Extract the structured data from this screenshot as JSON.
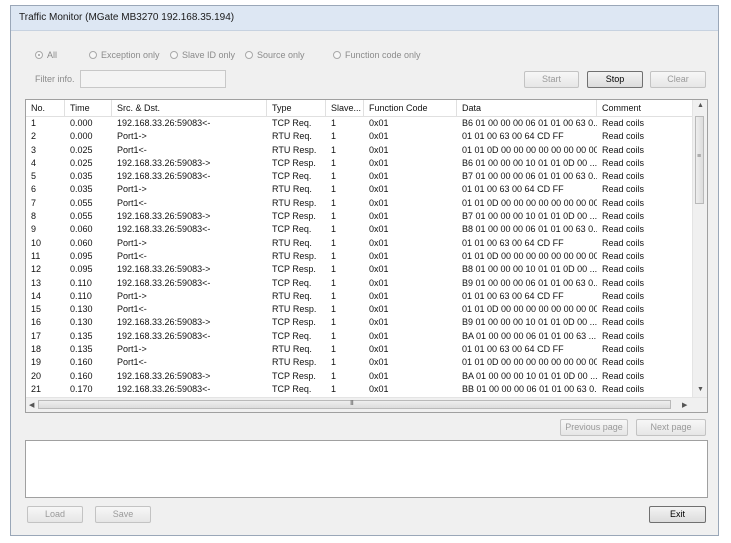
{
  "window": {
    "title": "Traffic Monitor (MGate MB3270 192.168.35.194)"
  },
  "filters": {
    "options": [
      {
        "label": "All",
        "selected": true
      },
      {
        "label": "Exception only",
        "selected": false
      },
      {
        "label": "Slave ID only",
        "selected": false
      },
      {
        "label": "Source only",
        "selected": false
      },
      {
        "label": "Function code only",
        "selected": false
      }
    ],
    "filter_label": "Filter info.",
    "filter_value": ""
  },
  "buttons": {
    "start": "Start",
    "stop": "Stop",
    "clear": "Clear",
    "previous_page": "Previous page",
    "next_page": "Next page",
    "load": "Load",
    "save": "Save",
    "exit": "Exit"
  },
  "table": {
    "columns": [
      "No.",
      "Time",
      "Src. & Dst.",
      "Type",
      "Slave...",
      "Function Code",
      "Data",
      "Comment"
    ],
    "rows": [
      [
        "1",
        "0.000",
        "192.168.33.26:59083<-",
        "TCP Req.",
        "1",
        "0x01",
        "B6 01 00 00 00 06 01 01 00 63 0...",
        "Read coils"
      ],
      [
        "2",
        "0.000",
        "Port1->",
        "RTU Req.",
        "1",
        "0x01",
        "01 01 00 63 00 64 CD FF",
        "Read coils"
      ],
      [
        "3",
        "0.025",
        "Port1<-",
        "RTU Resp.",
        "1",
        "0x01",
        "01 01 0D 00 00 00 00 00 00 00 00 ...",
        "Read coils"
      ],
      [
        "4",
        "0.025",
        "192.168.33.26:59083->",
        "TCP Resp.",
        "1",
        "0x01",
        "B6 01 00 00 00 10 01 01 0D 00 ...",
        "Read coils"
      ],
      [
        "5",
        "0.035",
        "192.168.33.26:59083<-",
        "TCP Req.",
        "1",
        "0x01",
        "B7 01 00 00 00 06 01 01 00 63 0...",
        "Read coils"
      ],
      [
        "6",
        "0.035",
        "Port1->",
        "RTU Req.",
        "1",
        "0x01",
        "01 01 00 63 00 64 CD FF",
        "Read coils"
      ],
      [
        "7",
        "0.055",
        "Port1<-",
        "RTU Resp.",
        "1",
        "0x01",
        "01 01 0D 00 00 00 00 00 00 00 00 ...",
        "Read coils"
      ],
      [
        "8",
        "0.055",
        "192.168.33.26:59083->",
        "TCP Resp.",
        "1",
        "0x01",
        "B7 01 00 00 00 10 01 01 0D 00 ...",
        "Read coils"
      ],
      [
        "9",
        "0.060",
        "192.168.33.26:59083<-",
        "TCP Req.",
        "1",
        "0x01",
        "B8 01 00 00 00 06 01 01 00 63 0...",
        "Read coils"
      ],
      [
        "10",
        "0.060",
        "Port1->",
        "RTU Req.",
        "1",
        "0x01",
        "01 01 00 63 00 64 CD FF",
        "Read coils"
      ],
      [
        "11",
        "0.095",
        "Port1<-",
        "RTU Resp.",
        "1",
        "0x01",
        "01 01 0D 00 00 00 00 00 00 00 00 ...",
        "Read coils"
      ],
      [
        "12",
        "0.095",
        "192.168.33.26:59083->",
        "TCP Resp.",
        "1",
        "0x01",
        "B8 01 00 00 00 10 01 01 0D 00 ...",
        "Read coils"
      ],
      [
        "13",
        "0.110",
        "192.168.33.26:59083<-",
        "TCP Req.",
        "1",
        "0x01",
        "B9 01 00 00 00 06 01 01 00 63 0...",
        "Read coils"
      ],
      [
        "14",
        "0.110",
        "Port1->",
        "RTU Req.",
        "1",
        "0x01",
        "01 01 00 63 00 64 CD FF",
        "Read coils"
      ],
      [
        "15",
        "0.130",
        "Port1<-",
        "RTU Resp.",
        "1",
        "0x01",
        "01 01 0D 00 00 00 00 00 00 00 00 ...",
        "Read coils"
      ],
      [
        "16",
        "0.130",
        "192.168.33.26:59083->",
        "TCP Resp.",
        "1",
        "0x01",
        "B9 01 00 00 00 10 01 01 0D 00 ...",
        "Read coils"
      ],
      [
        "17",
        "0.135",
        "192.168.33.26:59083<-",
        "TCP Req.",
        "1",
        "0x01",
        "BA 01 00 00 00 06 01 01 00 63 ...",
        "Read coils"
      ],
      [
        "18",
        "0.135",
        "Port1->",
        "RTU Req.",
        "1",
        "0x01",
        "01 01 00 63 00 64 CD FF",
        "Read coils"
      ],
      [
        "19",
        "0.160",
        "Port1<-",
        "RTU Resp.",
        "1",
        "0x01",
        "01 01 0D 00 00 00 00 00 00 00 00 ...",
        "Read coils"
      ],
      [
        "20",
        "0.160",
        "192.168.33.26:59083->",
        "TCP Resp.",
        "1",
        "0x01",
        "BA 01 00 00 00 10 01 01 0D 00 ...",
        "Read coils"
      ],
      [
        "21",
        "0.170",
        "192.168.33.26:59083<-",
        "TCP Req.",
        "1",
        "0x01",
        "BB 01 00 00 00 06 01 01 00 63 0...",
        "Read coils"
      ]
    ]
  },
  "scrollbar": {
    "horizontal_grip": "III",
    "vertical_grip": "≡"
  }
}
